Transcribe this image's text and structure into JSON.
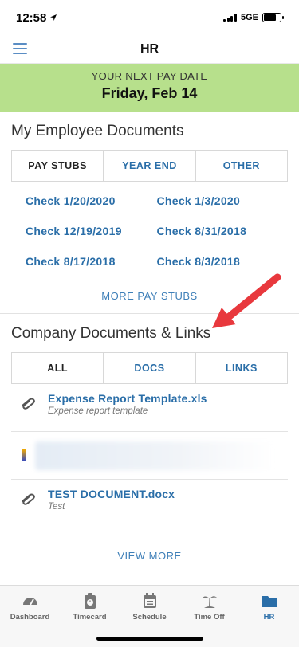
{
  "status": {
    "time": "12:58",
    "network": "5GE"
  },
  "header": {
    "title": "HR"
  },
  "pay": {
    "label": "YOUR NEXT PAY DATE",
    "date": "Friday, Feb 14"
  },
  "employee_docs": {
    "title": "My Employee Documents",
    "tabs": [
      "PAY STUBS",
      "YEAR END",
      "OTHER"
    ],
    "checks": [
      "Check 1/20/2020",
      "Check 1/3/2020",
      "Check 12/19/2019",
      "Check 8/31/2018",
      "Check 8/17/2018",
      "Check 8/3/2018"
    ],
    "more": "MORE PAY STUBS"
  },
  "company_docs": {
    "title": "Company Documents & Links",
    "tabs": [
      "ALL",
      "DOCS",
      "LINKS"
    ],
    "items": [
      {
        "name": "Expense Report Template.xls",
        "desc": "Expense report template"
      },
      {
        "name": "TEST DOCUMENT.docx",
        "desc": "Test"
      }
    ],
    "more": "VIEW MORE"
  },
  "tabbar": [
    "Dashboard",
    "Timecard",
    "Schedule",
    "Time Off",
    "HR"
  ]
}
